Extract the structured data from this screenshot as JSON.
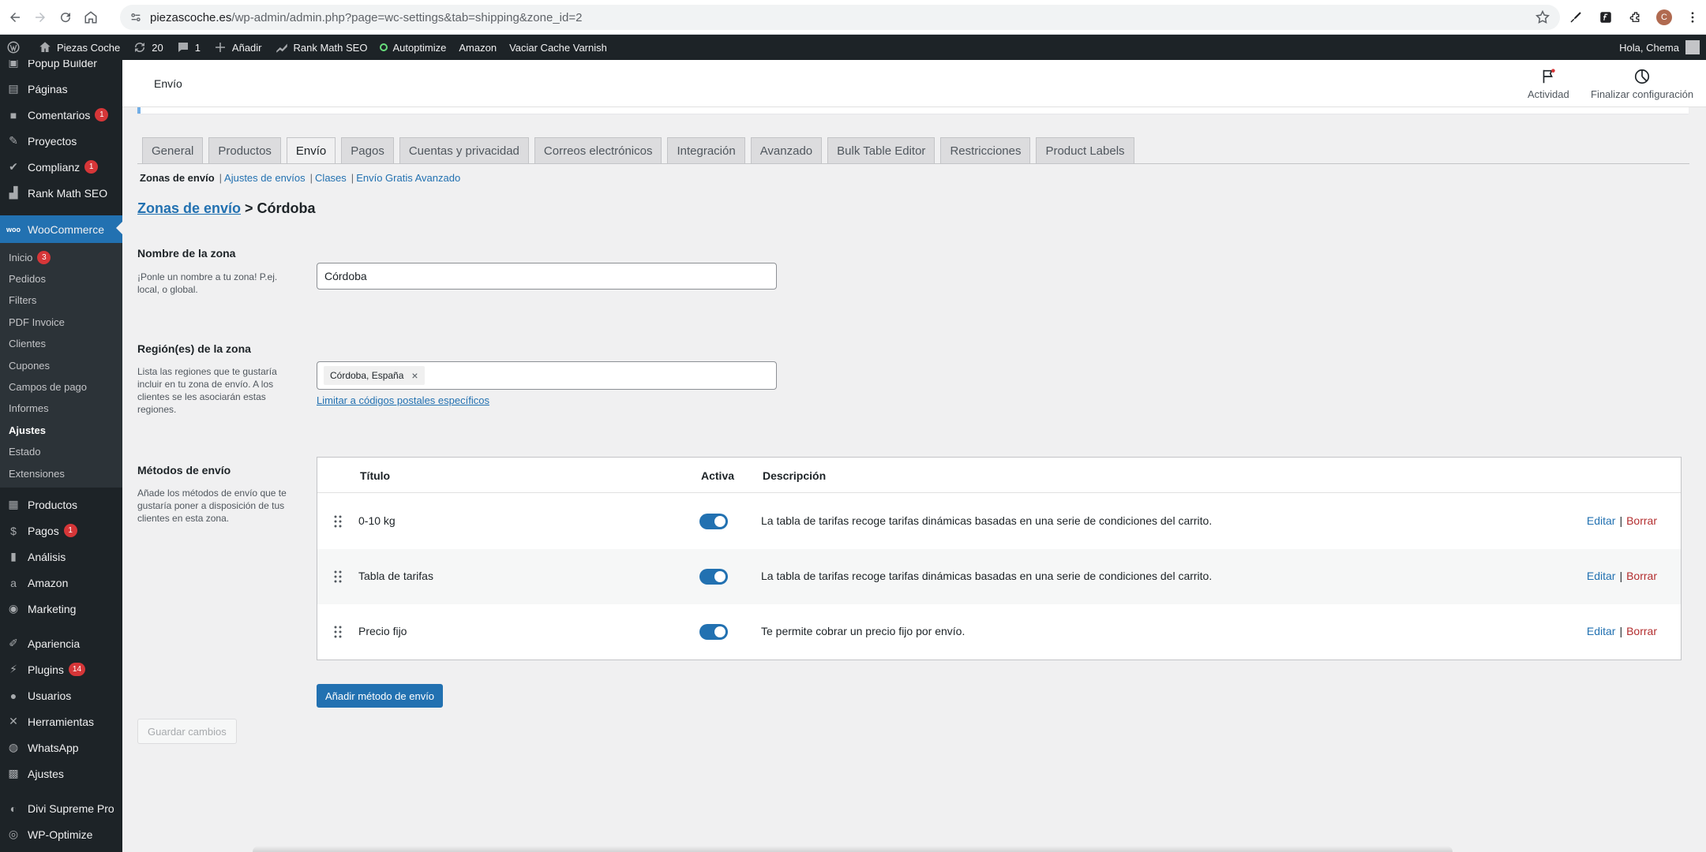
{
  "browser": {
    "url_host": "piezascoche.es",
    "url_path": "/wp-admin/admin.php?page=wc-settings&tab=shipping&zone_id=2",
    "profile_initial": "C"
  },
  "admin_bar": {
    "site_name": "Piezas Coche",
    "updates": "20",
    "comments": "1",
    "add_new": "Añadir",
    "rank_math": "Rank Math SEO",
    "autoptimize": "Autoptimize",
    "amazon": "Amazon",
    "varnish": "Vaciar Cache Varnish",
    "greeting": "Hola, Chema"
  },
  "sidebar": {
    "items": [
      {
        "label": "Popup Builder",
        "badge": ""
      },
      {
        "label": "Páginas",
        "badge": ""
      },
      {
        "label": "Comentarios",
        "badge": "1"
      },
      {
        "label": "Proyectos",
        "badge": ""
      },
      {
        "label": "Complianz",
        "badge": "1"
      },
      {
        "label": "Rank Math SEO",
        "badge": ""
      },
      {
        "label": "WooCommerce",
        "badge": ""
      }
    ],
    "submenu": [
      {
        "label": "Inicio",
        "badge": "3"
      },
      {
        "label": "Pedidos",
        "badge": ""
      },
      {
        "label": "Filters",
        "badge": ""
      },
      {
        "label": "PDF Invoice",
        "badge": ""
      },
      {
        "label": "Clientes",
        "badge": ""
      },
      {
        "label": "Cupones",
        "badge": ""
      },
      {
        "label": "Campos de pago",
        "badge": ""
      },
      {
        "label": "Informes",
        "badge": ""
      },
      {
        "label": "Ajustes",
        "badge": ""
      },
      {
        "label": "Estado",
        "badge": ""
      },
      {
        "label": "Extensiones",
        "badge": ""
      }
    ],
    "items_bottom": [
      {
        "label": "Productos",
        "badge": ""
      },
      {
        "label": "Pagos",
        "badge": "1"
      },
      {
        "label": "Análisis",
        "badge": ""
      },
      {
        "label": "Amazon",
        "badge": ""
      },
      {
        "label": "Marketing",
        "badge": ""
      },
      {
        "label": "Apariencia",
        "badge": ""
      },
      {
        "label": "Plugins",
        "badge": "14"
      },
      {
        "label": "Usuarios",
        "badge": ""
      },
      {
        "label": "Herramientas",
        "badge": ""
      },
      {
        "label": "WhatsApp",
        "badge": ""
      },
      {
        "label": "Ajustes",
        "badge": ""
      },
      {
        "label": "Divi Supreme Pro",
        "badge": ""
      },
      {
        "label": "WP-Optimize",
        "badge": ""
      }
    ]
  },
  "header": {
    "title": "Envío",
    "activity": "Actividad",
    "finish_setup": "Finalizar configuración"
  },
  "tabs": [
    "General",
    "Productos",
    "Envío",
    "Pagos",
    "Cuentas y privacidad",
    "Correos electrónicos",
    "Integración",
    "Avanzado",
    "Bulk Table Editor",
    "Restricciones",
    "Product Labels"
  ],
  "sections": {
    "current": "Zonas de envío",
    "others": [
      "Ajustes de envíos",
      "Clases",
      "Envío Gratis Avanzado"
    ]
  },
  "breadcrumb": {
    "link": "Zonas de envío",
    "current": "> Córdoba"
  },
  "zone_name": {
    "label": "Nombre de la zona",
    "desc": "¡Ponle un nombre a tu zona! P.ej. local, o global.",
    "value": "Córdoba"
  },
  "zone_regions": {
    "label": "Región(es) de la zona",
    "desc": "Lista las regiones que te gustaría incluir en tu zona de envío. A los clientes se les asociarán estas regiones.",
    "chip": "Córdoba, España",
    "chip_remove": "×",
    "postcode_link": "Limitar a códigos postales específicos"
  },
  "methods": {
    "label": "Métodos de envío",
    "desc": "Añade los métodos de envío que te gustaría poner a disposición de tus clientes en esta zona.",
    "col_title": "Título",
    "col_active": "Activa",
    "col_desc": "Descripción",
    "edit": "Editar",
    "delete": "Borrar",
    "separator": "|",
    "rows": [
      {
        "title": "0-10 kg",
        "active": true,
        "desc": "La tabla de tarifas recoge tarifas dinámicas basadas en una serie de condiciones del carrito."
      },
      {
        "title": "Tabla de tarifas",
        "active": true,
        "desc": "La tabla de tarifas recoge tarifas dinámicas basadas en una serie de condiciones del carrito."
      },
      {
        "title": "Precio fijo",
        "active": true,
        "desc": "Te permite cobrar un precio fijo por envío."
      }
    ]
  },
  "buttons": {
    "add_method": "Añadir método de envío",
    "save": "Guardar cambios"
  }
}
